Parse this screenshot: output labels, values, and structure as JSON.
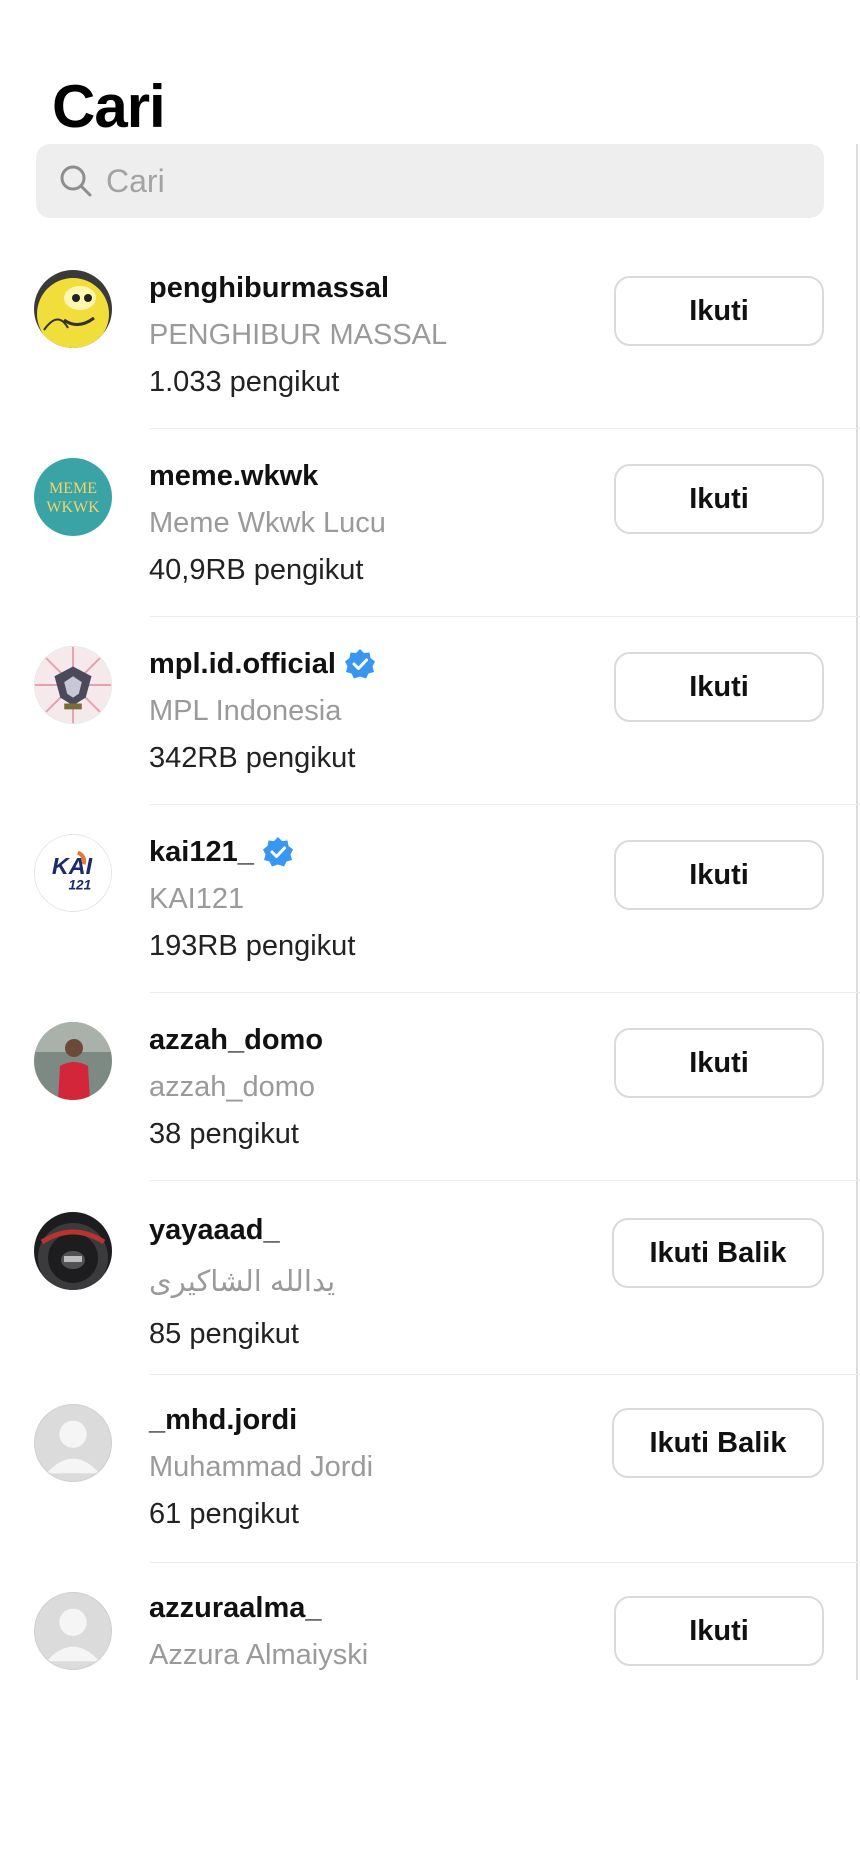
{
  "header": {
    "title": "Cari"
  },
  "search": {
    "placeholder": "Cari"
  },
  "users": [
    {
      "username": "penghiburmassal",
      "display_name": "PENGHIBUR MASSAL",
      "followers": "1.033 pengikut",
      "verified": false,
      "action": "Ikuti",
      "avatar_icon": "cartoon-avatar"
    },
    {
      "username": "meme.wkwk",
      "display_name": "Meme Wkwk Lucu",
      "followers": "40,9RB pengikut",
      "verified": false,
      "action": "Ikuti",
      "avatar_icon": "meme-logo-avatar",
      "avatar_text": [
        "MEME",
        "WKWK"
      ]
    },
    {
      "username": "mpl.id.official",
      "display_name": "MPL Indonesia",
      "followers": "342RB pengikut",
      "verified": true,
      "action": "Ikuti",
      "avatar_icon": "mpl-logo-avatar"
    },
    {
      "username": "kai121_",
      "display_name": "KAI121",
      "followers": "193RB pengikut",
      "verified": true,
      "action": "Ikuti",
      "avatar_icon": "kai-logo-avatar",
      "avatar_text": [
        "KAI",
        "121"
      ]
    },
    {
      "username": "azzah_domo",
      "display_name": "azzah_domo",
      "followers": "38 pengikut",
      "verified": false,
      "action": "Ikuti",
      "avatar_icon": "photo-avatar"
    },
    {
      "username": "yayaaad_",
      "display_name": "يدالله الشاكيرى",
      "followers": "85 pengikut",
      "verified": false,
      "action": "Ikuti Balik",
      "avatar_icon": "steering-wheel-avatar"
    },
    {
      "username": "_mhd.jordi",
      "display_name": "Muhammad Jordi",
      "followers": "61 pengikut",
      "verified": false,
      "action": "Ikuti Balik",
      "avatar_icon": "default-avatar"
    },
    {
      "username": "azzuraalma_",
      "display_name": "Azzura Almaiyski",
      "followers": "",
      "verified": false,
      "action": "Ikuti",
      "avatar_icon": "default-avatar"
    }
  ],
  "colors": {
    "verified": "#3897f0",
    "search_bg": "#eeeeee",
    "muted_text": "#9a9a9a"
  }
}
